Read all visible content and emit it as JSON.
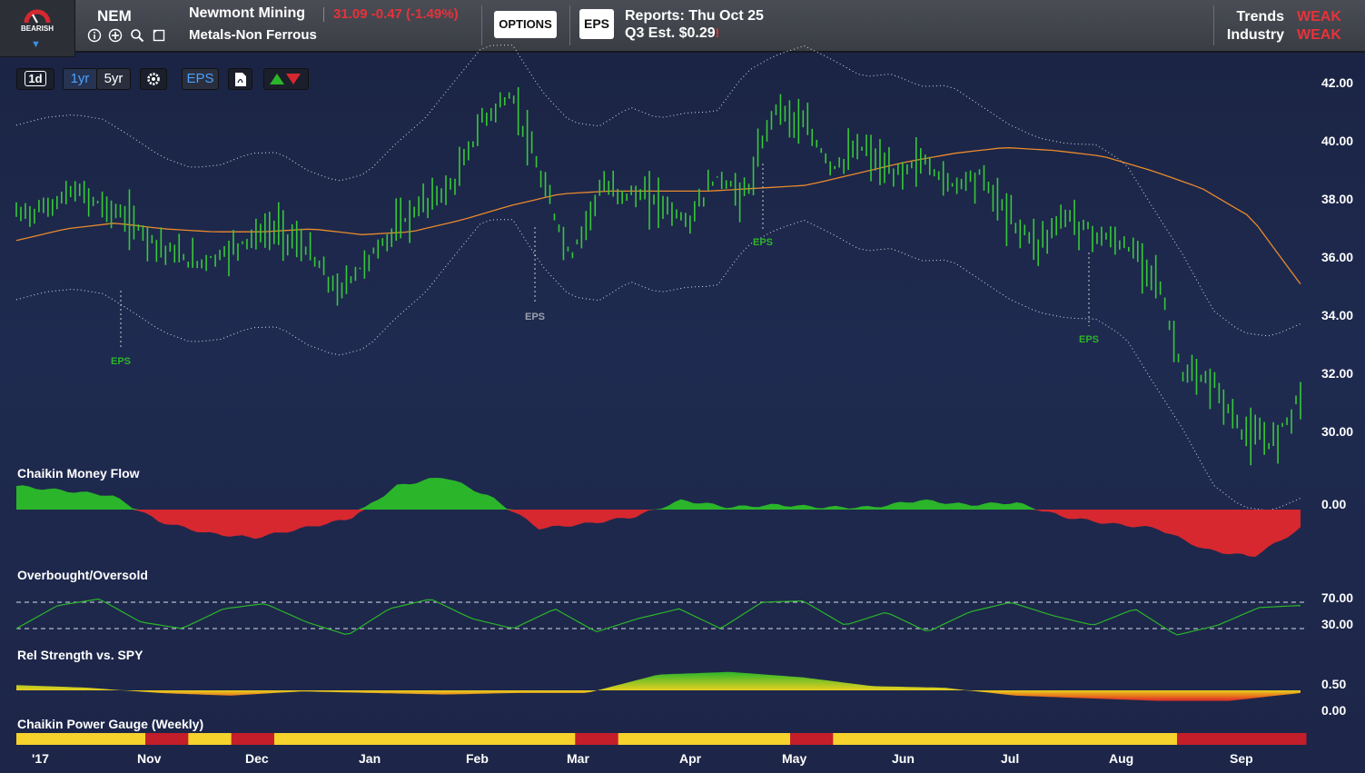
{
  "rating": {
    "label": "BEARISH"
  },
  "header": {
    "ticker": "NEM",
    "company": "Newmont Mining",
    "price_text": "31.09 -0.47 (-1.49%)",
    "industry": "Metals-Non Ferrous",
    "options_label": "OPTIONS",
    "eps_button": "EPS",
    "reports_line1": "Reports:  Thu Oct 25",
    "reports_line2": "Q3  Est.  $0.29",
    "reports_alert": "!",
    "trends_label": "Trends",
    "trends_value": "WEAK",
    "industry_label": "Industry",
    "industry_value": "WEAK"
  },
  "toolbar": {
    "one_day": "1d",
    "one_year": "1yr",
    "five_year": "5yr",
    "eps": "EPS"
  },
  "icons": [
    "bearish-gauge-icon",
    "info-icon",
    "add-icon",
    "search-icon",
    "note-icon",
    "settings-icon",
    "pdf-icon",
    "up-down-arrows-icon"
  ],
  "colors": {
    "bullish": "#2bb52a",
    "bearish": "#d7282f",
    "accent_blue": "#4aa0ff",
    "price_bars": "#37c83a",
    "moving_avg": "#e98a2c",
    "power_yellow": "#f5d22c",
    "power_red": "#c41e2a"
  },
  "y_axis": [
    "42.00",
    "40.00",
    "38.00",
    "36.00",
    "34.00",
    "32.00",
    "30.00"
  ],
  "eps_markers": [
    {
      "label": "EPS",
      "month_hint": "late Oct",
      "color": "green"
    },
    {
      "label": "EPS",
      "month_hint": "mid Feb",
      "color": "gray"
    },
    {
      "label": "EPS",
      "month_hint": "late Apr",
      "color": "green"
    },
    {
      "label": "EPS",
      "month_hint": "late Jul",
      "color": "green"
    }
  ],
  "panels": {
    "cmf": {
      "title": "Chaikin Money Flow",
      "y_label": "0.00"
    },
    "obos": {
      "title": "Overbought/Oversold",
      "y_labels": [
        "70.00",
        "30.00"
      ]
    },
    "rs": {
      "title": "Rel Strength vs. SPY",
      "y_labels": [
        "0.50",
        "0.00"
      ]
    },
    "power": {
      "title": "Chaikin Power Gauge (Weekly)"
    }
  },
  "x_axis": [
    "'17",
    "Nov",
    "Dec",
    "Jan",
    "Feb",
    "Mar",
    "Apr",
    "May",
    "Jun",
    "Jul",
    "Aug",
    "Sep"
  ],
  "chart_data": {
    "type": "bar",
    "title": "",
    "ylim": [
      29.0,
      43.0
    ],
    "series": [
      {
        "name": "price_close",
        "values": [
          37.5,
          37.7,
          38.3,
          37.8,
          37.2,
          36.4,
          35.8,
          36.1,
          36.7,
          37.0,
          36.2,
          34.8,
          35.9,
          37.0,
          37.9,
          38.5,
          40.8,
          41.6,
          38.6,
          36.0,
          38.4,
          38.2,
          38.0,
          37.2,
          38.8,
          38.1,
          41.3,
          40.5,
          39.1,
          39.8,
          38.8,
          39.4,
          38.5,
          38.9,
          37.4,
          36.5,
          37.5,
          36.8,
          36.4,
          35.6,
          31.9,
          31.7,
          30.0,
          29.6,
          31.3
        ]
      },
      {
        "name": "moving_average",
        "values": [
          36.6,
          37.0,
          37.2,
          37.0,
          36.9,
          36.9,
          37.0,
          36.8,
          36.9,
          37.3,
          37.8,
          38.2,
          38.3,
          38.3,
          38.3,
          38.4,
          38.5,
          38.9,
          39.3,
          39.6,
          39.8,
          39.7,
          39.5,
          39.0,
          38.4,
          37.4,
          35.1
        ]
      },
      {
        "name": "cmf",
        "values": [
          0.1,
          0.08,
          0.06,
          -0.05,
          -0.1,
          -0.12,
          -0.08,
          -0.04,
          0.1,
          0.14,
          0.05,
          -0.08,
          -0.06,
          -0.03,
          0.04,
          0.01,
          0.02,
          0.01,
          0.01,
          0.04,
          0.02,
          0.03,
          -0.03,
          -0.06,
          -0.08,
          -0.17,
          -0.2,
          -0.08
        ]
      },
      {
        "name": "obos",
        "values": [
          30,
          65,
          75,
          40,
          30,
          60,
          68,
          40,
          20,
          60,
          75,
          45,
          30,
          60,
          25,
          45,
          60,
          30,
          70,
          72,
          35,
          55,
          25,
          55,
          70,
          50,
          35,
          60,
          20,
          35,
          62,
          65
        ]
      },
      {
        "name": "rel_strength",
        "values": [
          0.1,
          0.05,
          -0.05,
          -0.1,
          -0.02,
          -0.05,
          -0.08,
          -0.05,
          -0.05,
          0.3,
          0.35,
          0.25,
          0.08,
          0.05,
          -0.1,
          -0.15,
          -0.2,
          -0.2,
          -0.05
        ]
      },
      {
        "name": "power_gauge_weekly",
        "values": [
          "neutral",
          "neutral",
          "neutral",
          "bearish",
          "neutral",
          "bearish",
          "neutral",
          "neutral",
          "neutral",
          "neutral",
          "neutral",
          "neutral",
          "neutral",
          "bearish",
          "neutral",
          "neutral",
          "neutral",
          "neutral",
          "bearish",
          "neutral",
          "neutral",
          "neutral",
          "neutral",
          "neutral",
          "neutral",
          "neutral",
          "neutral",
          "bearish",
          "bearish",
          "bearish"
        ]
      }
    ]
  }
}
